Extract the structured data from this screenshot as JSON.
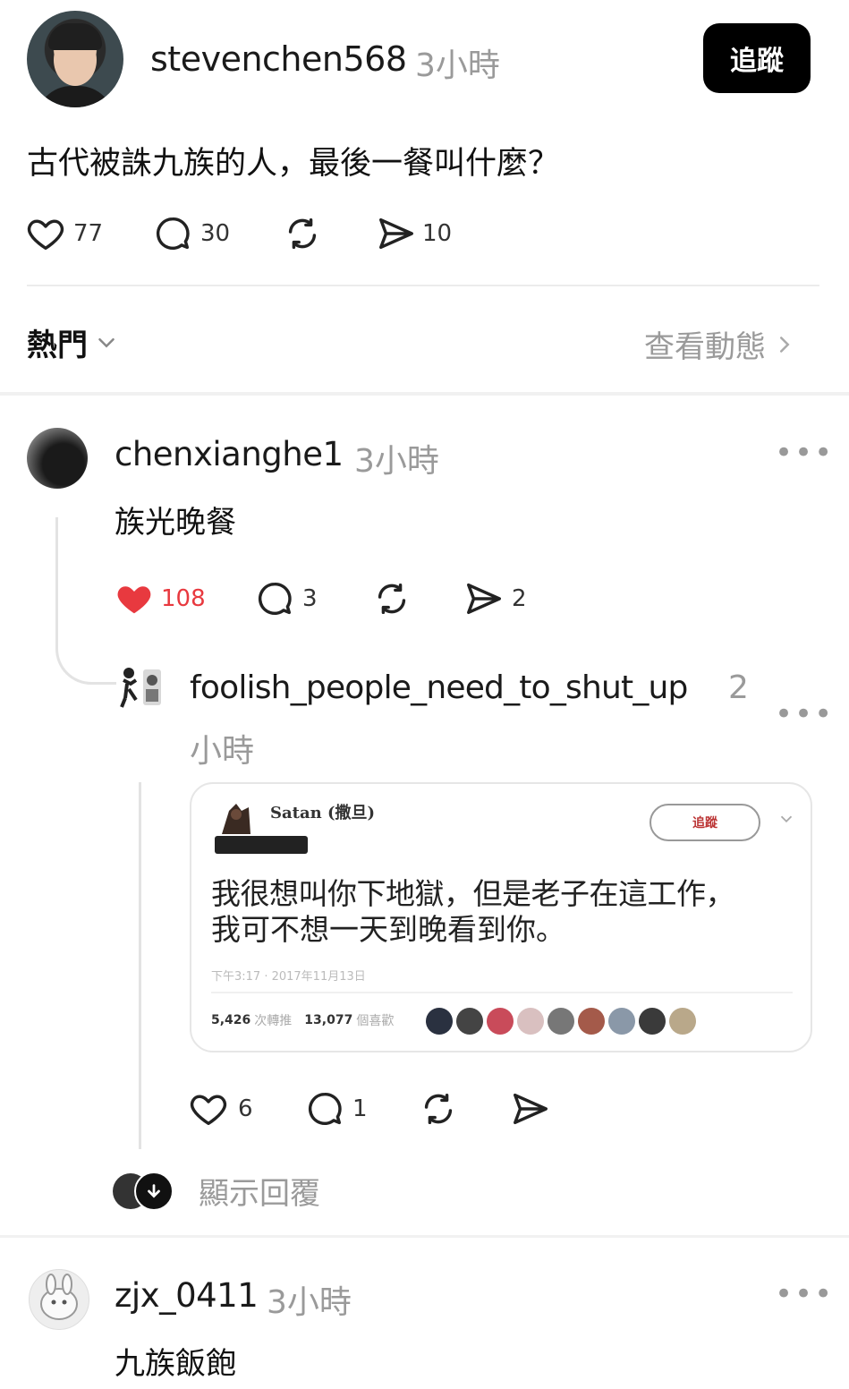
{
  "post": {
    "username": "stevenchen568",
    "time": "3小時",
    "follow_label": "追蹤",
    "text": "古代被誅九族的人，最後一餐叫什麼？",
    "likes": "77",
    "comments": "30",
    "shares": "10"
  },
  "sort": {
    "label": "熱門",
    "view_activity": "查看動態"
  },
  "replies": [
    {
      "username": "chenxianghe1",
      "time": "3小時",
      "text": "族光晚餐",
      "likes": "108",
      "comments": "3",
      "shares": "2",
      "liked": true
    },
    {
      "username": "foolish_people_need_to_shut_up",
      "time_num": "2",
      "time_unit": "小時",
      "likes": "6",
      "comments": "1",
      "embed": {
        "name": "Satan (撒旦)",
        "follow_btn": "追蹤",
        "text_line1": "我很想叫你下地獄，但是老子在這工作，",
        "text_line2": "我可不想一天到晚看到你。",
        "timestamp": "下午3:17 · 2017年11月13日",
        "retweets": "5,426",
        "retweets_label": "次轉推",
        "likes": "13,077",
        "likes_label": "個喜歡"
      }
    },
    {
      "username": "zjx_0411",
      "time": "3小時",
      "text": "九族飯飽"
    }
  ],
  "show_replies": "顯示回覆",
  "colors": {
    "heart_liked": "#e8393f",
    "follow_bg": "#000000"
  }
}
